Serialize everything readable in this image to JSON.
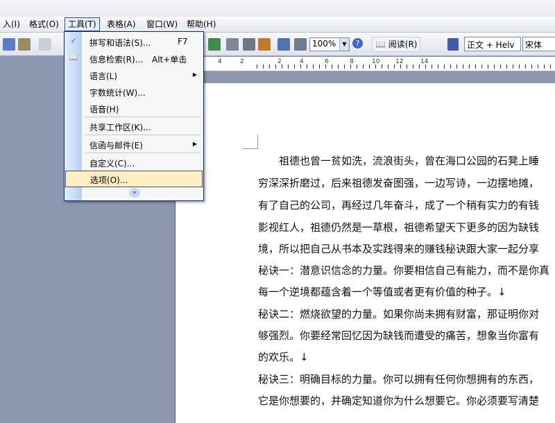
{
  "menubar": {
    "items": [
      {
        "label": "插入(I)",
        "display": "入(I)"
      },
      {
        "label": "格式(O)"
      },
      {
        "label": "工具(T)"
      },
      {
        "label": "表格(A)"
      },
      {
        "label": "窗口(W)"
      },
      {
        "label": "帮助(H)"
      }
    ]
  },
  "toolbar": {
    "zoom": "100%",
    "read_label": "阅读(R)",
    "style_value": "正文 + Helv",
    "font_value": "宋体"
  },
  "ruler": {
    "numbers": [
      "4",
      "2",
      "2",
      "4",
      "6",
      "8",
      "10",
      "12",
      "14"
    ]
  },
  "tools_menu": {
    "items": [
      {
        "label": "拼写和语法(S)...",
        "shortcut": "F7",
        "icon": "spelling-icon"
      },
      {
        "label": "信息检索(R)...",
        "shortcut": "Alt+单击",
        "icon": "research-icon"
      },
      {
        "label": "语言(L)",
        "submenu": true
      },
      {
        "label": "字数统计(W)..."
      },
      {
        "label": "语音(H)"
      },
      {
        "label": "共享工作区(K)..."
      },
      {
        "label": "信函与邮件(E)",
        "submenu": true
      },
      {
        "label": "自定义(C)..."
      },
      {
        "label": "选项(O)...",
        "highlighted": true
      }
    ]
  },
  "document": {
    "lines": [
      "祖德也曾一贫如洗，流浪街头，曾在海口公园的石凳上睡",
      "穷深深折磨过，后来祖德发奋图强，一边写诗，一边摆地摊，",
      "有了自己的公司，再经过几年奋斗，成了一个稍有实力的有钱",
      "影视红人，祖德仍然是一草根，祖德希望天下更多的因为缺钱",
      "境，所以把自己从书本及实践得来的赚钱秘诀跟大家一起分享",
      "秘诀一：潜意识信念的力量。你要相信自己有能力，而不是你真",
      "每一个逆境都蕴含着一个等值或者更有价值的种子。↓",
      "秘诀二：燃烧欲望的力量。如果你尚未拥有财富，那证明你对",
      "够强烈。你要经常回忆因为缺钱而遭受的痛苦，想象当你富有",
      "的欢乐。↓",
      "秘诀三：明确目标的力量。你可以拥有任何你想拥有的东西，",
      "它是你想要的，并确定知道你为什么想要它。你必须要写清楚"
    ]
  }
}
